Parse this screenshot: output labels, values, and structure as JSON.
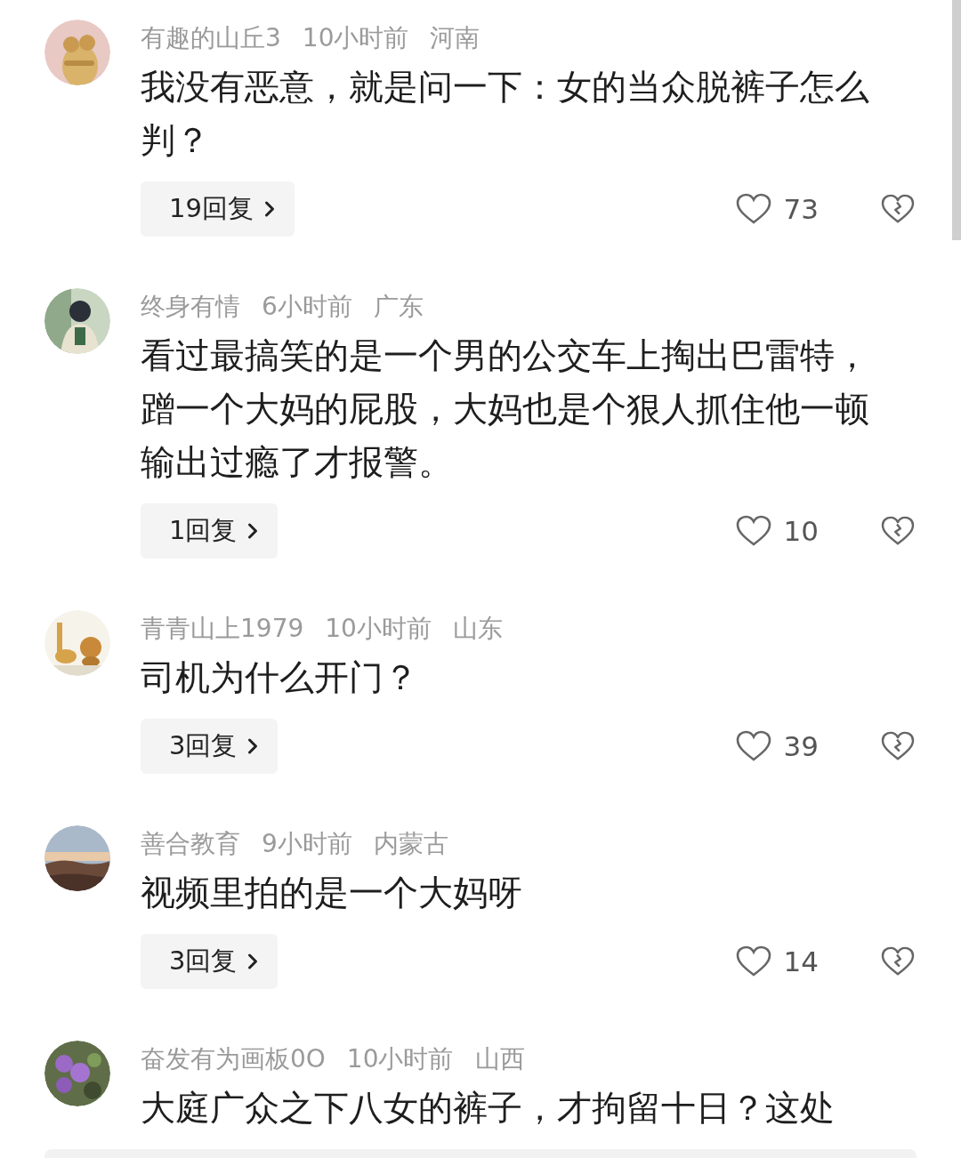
{
  "comments": [
    {
      "user": "有趣的山丘3",
      "time": "10小时前",
      "region": "河南",
      "text": "我没有恶意，就是问一下：女的当众脱裤子怎么判？",
      "replies": "19回复",
      "likes": "73"
    },
    {
      "user": "终身有情",
      "time": "6小时前",
      "region": "广东",
      "text": "看过最搞笑的是一个男的公交车上掏出巴雷特，蹭一个大妈的屁股，大妈也是个狠人抓住他一顿输出过瘾了才报警。",
      "replies": "1回复",
      "likes": "10"
    },
    {
      "user": "青青山上1979",
      "time": "10小时前",
      "region": "山东",
      "text": "司机为什么开门？",
      "replies": "3回复",
      "likes": "39"
    },
    {
      "user": "善合教育",
      "time": "9小时前",
      "region": "内蒙古",
      "text": "视频里拍的是一个大妈呀",
      "replies": "3回复",
      "likes": "14"
    },
    {
      "user": "奋发有为画板0O",
      "time": "10小时前",
      "region": "山西",
      "text": "大庭广众之下八女的裤子，才拘留十日？这处"
    }
  ]
}
